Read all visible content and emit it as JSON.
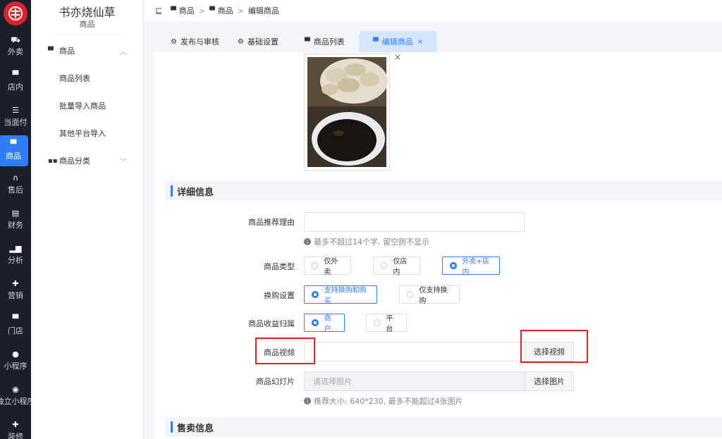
{
  "rail": {
    "items": [
      {
        "label": "外卖",
        "icon": "scooter-icon"
      },
      {
        "label": "店内",
        "icon": "store-icon"
      },
      {
        "label": "当面付",
        "icon": "list-icon"
      },
      {
        "label": "商品",
        "icon": "bag-icon"
      },
      {
        "label": "售后",
        "icon": "headset-icon"
      },
      {
        "label": "财务",
        "icon": "finance-icon"
      },
      {
        "label": "分析",
        "icon": "bar-chart-icon"
      },
      {
        "label": "营销",
        "icon": "gift-icon"
      },
      {
        "label": "门店",
        "icon": "shop-icon"
      },
      {
        "label": "小程序",
        "icon": "chat-icon"
      },
      {
        "label": "独立小程序",
        "icon": "miniapp-icon"
      },
      {
        "label": "装修",
        "icon": "decorate-icon"
      }
    ],
    "active_index": 3
  },
  "submenu": {
    "brand": "书亦烧仙草",
    "subtitle": "商品",
    "group1": "商品",
    "children": [
      "商品列表",
      "批量导入商品",
      "其他平台导入"
    ],
    "group2": "商品分类"
  },
  "breadcrumb": [
    "商品",
    "商品",
    "编辑商品"
  ],
  "tabs": [
    {
      "label": "发布与审核"
    },
    {
      "label": "基础设置"
    },
    {
      "label": "商品列表"
    },
    {
      "label": "编辑商品",
      "close": "×"
    }
  ],
  "image_close": "×",
  "sections": {
    "detail": "详细信息",
    "sale": "售卖信息"
  },
  "form": {
    "recommend_label": "商品推荐理由",
    "recommend_value": "",
    "recommend_hint": "最多不超过14个字, 留空则不显示",
    "type_label": "商品类型",
    "type_options": [
      "仅外卖",
      "仅店内",
      "外卖+店内"
    ],
    "type_selected": 2,
    "exchange_label": "换购设置",
    "exchange_options": [
      "支持换购和购买",
      "仅支持换购"
    ],
    "exchange_selected": 0,
    "revenue_label": "商品收益归属",
    "revenue_options": [
      "商户",
      "平台"
    ],
    "revenue_selected": 0,
    "video_label": "商品视频",
    "video_value": "",
    "video_button": "选择视频",
    "slides_label": "商品幻灯片",
    "slides_placeholder": "请选择图片",
    "slides_button": "选择图片",
    "slides_hint": "推荐大小: 640*230, 最多不能超过4张图片"
  },
  "colors": {
    "accent": "#2f7ef5",
    "rail_bg": "#1b1f2b",
    "highlight_red": "#e02424",
    "logo_red": "#d9232d"
  }
}
